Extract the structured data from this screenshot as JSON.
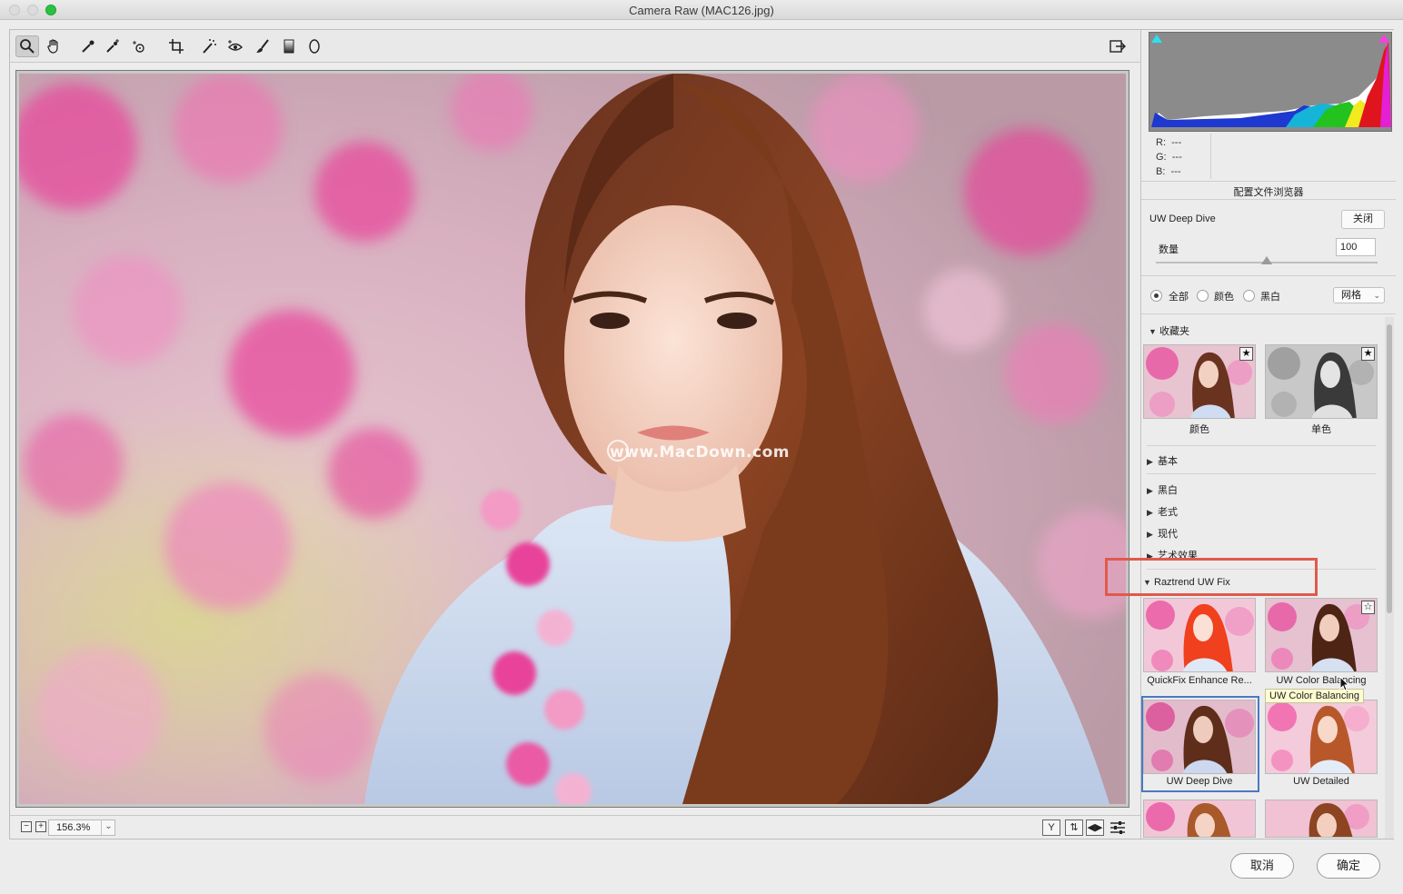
{
  "window": {
    "title": "Camera Raw (MAC126.jpg)"
  },
  "toolbar": {
    "tools": [
      "zoom-tool",
      "hand-tool",
      "white-balance-tool",
      "color-sampler-tool",
      "targeted-adjustment-tool",
      "crop-tool",
      "spot-removal-tool",
      "red-eye-tool",
      "adjustment-brush-tool",
      "graduated-filter-tool",
      "radial-filter-tool"
    ],
    "open_prefs_icon": "open-in-photoshop-icon"
  },
  "preview": {
    "watermark": "www.MacDown.com"
  },
  "bottombar": {
    "zoom_value": "156.3%",
    "zoom_out": "−",
    "zoom_in": "+",
    "view_y": "Y",
    "view_swap": "⇅",
    "view_toggle": "◀▶",
    "settings_icon": "sliders-icon"
  },
  "histogram": {
    "r_label": "R:",
    "r_value": "---",
    "g_label": "G:",
    "g_value": "---",
    "b_label": "B:",
    "b_value": "---"
  },
  "profile_browser": {
    "title": "配置文件浏览器",
    "profile_name": "UW Deep Dive",
    "close_label": "关闭",
    "amount_label": "数量",
    "amount_value": "100",
    "amount_level": 1.0,
    "filter": {
      "all": "全部",
      "color": "颜色",
      "bw": "黑白",
      "selected": "all"
    },
    "view_select": "网格",
    "groups": {
      "favorites": {
        "label": "收藏夹",
        "items": [
          "颜色",
          "单色"
        ]
      },
      "basic": "基本",
      "bw": "黑白",
      "vintage": "老式",
      "modern": "现代",
      "artistic": "艺术效果",
      "raztrend": {
        "label": "Raztrend UW Fix",
        "items": [
          "QuickFix Enhance Re...",
          "UW Color Balancing",
          "UW Deep Dive",
          "UW Detailed"
        ]
      }
    },
    "tooltip": "UW Color Balancing"
  },
  "footer": {
    "cancel_label": "取消",
    "ok_label": "确定"
  },
  "colors": {
    "highlight": "#e0594d",
    "selected": "#4b78c5",
    "accent_pink": "#e8439a"
  }
}
